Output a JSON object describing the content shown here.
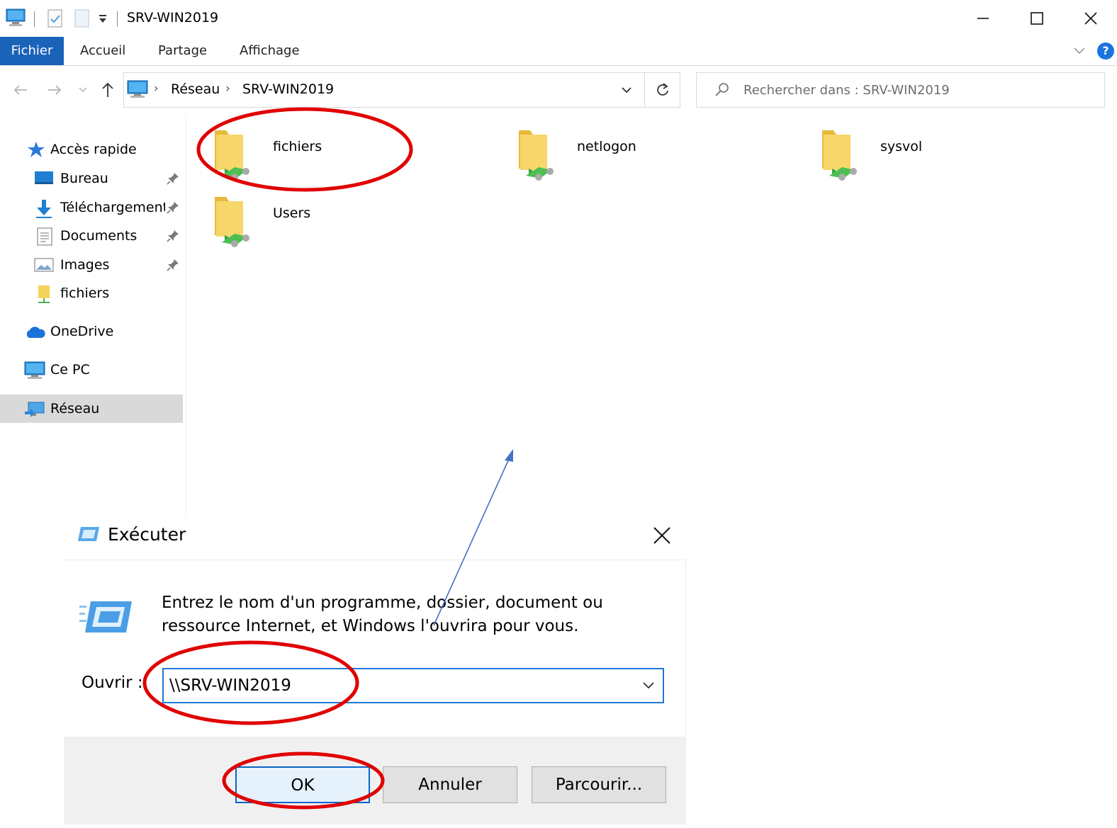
{
  "window": {
    "title": "SRV-WIN2019"
  },
  "ribbon": {
    "tabs": [
      "Fichier",
      "Accueil",
      "Partage",
      "Affichage"
    ],
    "help_glyph": "?"
  },
  "address": {
    "crumbs": [
      "Réseau",
      "SRV-WIN2019"
    ],
    "separator_glyph": "›"
  },
  "search": {
    "placeholder": "Rechercher dans : SRV-WIN2019"
  },
  "sidebar": {
    "items": [
      {
        "label": "Accès rapide",
        "icon": "star-icon"
      },
      {
        "label": "Bureau",
        "icon": "desktop-icon",
        "pinned": true
      },
      {
        "label": "Téléchargements",
        "icon": "download-arrow-icon",
        "pinned": true
      },
      {
        "label": "Documents",
        "icon": "document-icon",
        "pinned": true
      },
      {
        "label": "Images",
        "icon": "image-icon",
        "pinned": true
      },
      {
        "label": "fichiers",
        "icon": "network-folder-icon"
      },
      {
        "label": "OneDrive",
        "icon": "cloud-icon"
      },
      {
        "label": "Ce PC",
        "icon": "computer-icon"
      },
      {
        "label": "Réseau",
        "icon": "network-icon",
        "selected": true
      }
    ]
  },
  "content": {
    "items": [
      {
        "label": "fichiers",
        "icon": "shared-folder-icon"
      },
      {
        "label": "netlogon",
        "icon": "shared-folder-icon"
      },
      {
        "label": "sysvol",
        "icon": "shared-folder-icon"
      },
      {
        "label": "Users",
        "icon": "shared-folder-icon"
      }
    ]
  },
  "run_dialog": {
    "title": "Exécuter",
    "description_line1": "Entrez le nom d'un programme, dossier, document ou",
    "description_line2": "ressource Internet, et Windows l'ouvrira pour vous.",
    "open_label": "Ouvrir :",
    "open_value": "\\\\SRV-WIN2019",
    "buttons": {
      "ok": "OK",
      "cancel": "Annuler",
      "browse": "Parcourir..."
    }
  },
  "annotations": {
    "highlight_color": "#e00000",
    "arrow_color": "#4472c4"
  }
}
